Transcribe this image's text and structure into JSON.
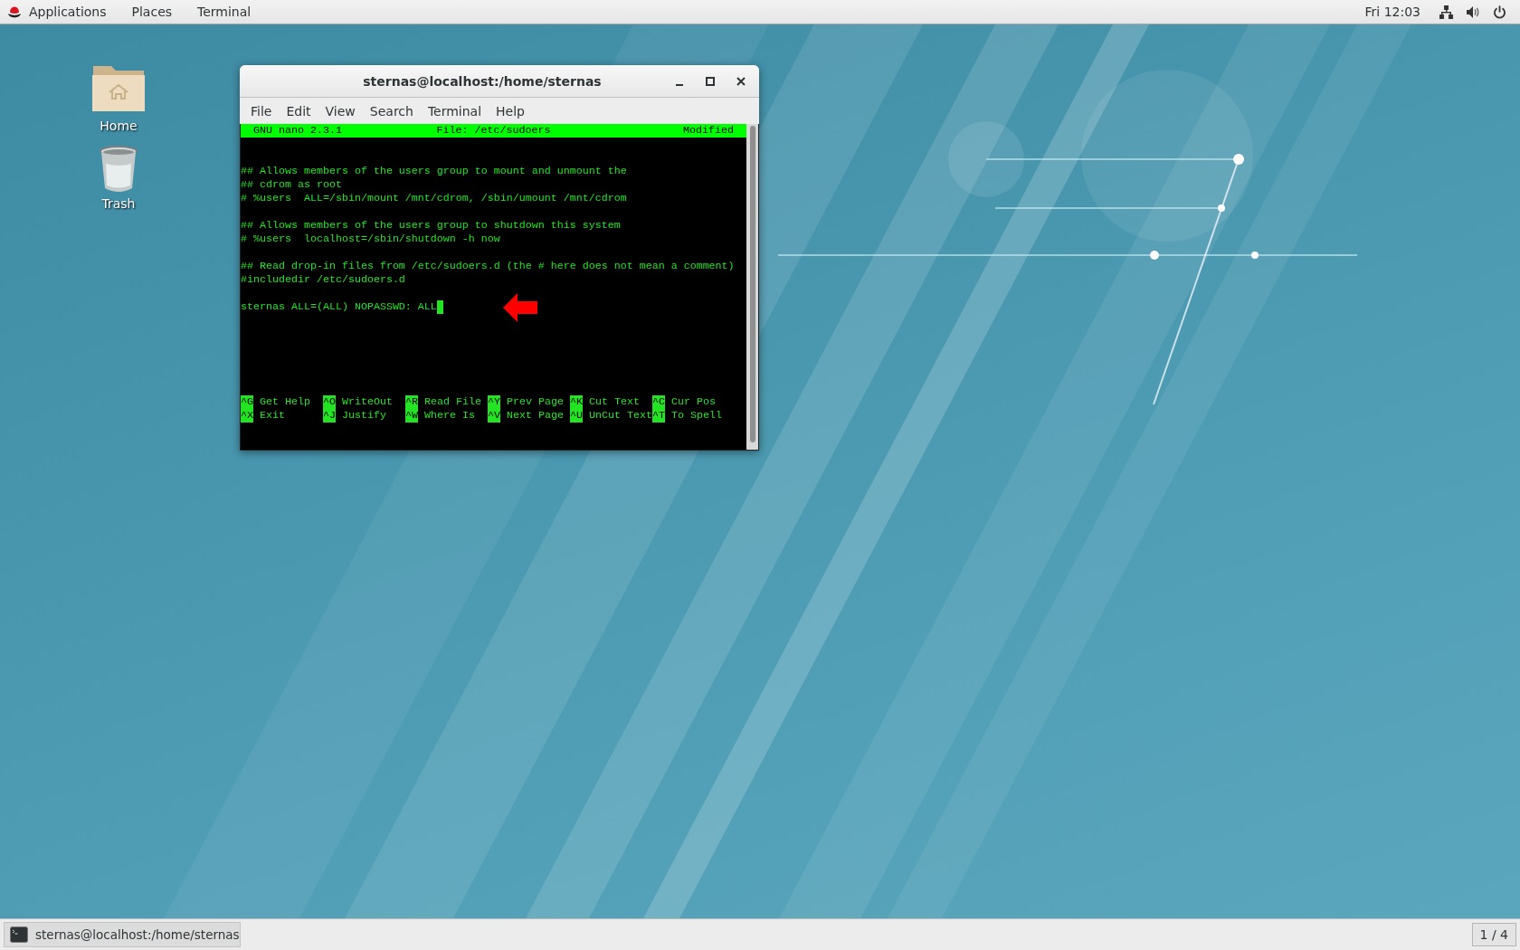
{
  "top_bar": {
    "menus": [
      {
        "label": "Applications"
      },
      {
        "label": "Places"
      },
      {
        "label": "Terminal"
      }
    ],
    "clock": "Fri 12:03"
  },
  "desktop_icons": [
    {
      "label": "Home",
      "kind": "folder"
    },
    {
      "label": "Trash",
      "kind": "trash"
    }
  ],
  "window": {
    "title": "sternas@localhost:/home/sternas",
    "menu": [
      "File",
      "Edit",
      "View",
      "Search",
      "Terminal",
      "Help"
    ],
    "nano": {
      "version": "GNU nano 2.3.1",
      "file": "File: /etc/sudoers",
      "status": "Modified",
      "blocks": [
        [
          {
            "text": "## Allows members of the users group to mount and unmount the",
            "cursor": false
          },
          {
            "text": "## cdrom as root",
            "cursor": false
          },
          {
            "text": "# %users  ALL=/sbin/mount /mnt/cdrom, /sbin/umount /mnt/cdrom",
            "cursor": false
          }
        ],
        [
          {
            "text": "## Allows members of the users group to shutdown this system",
            "cursor": false
          },
          {
            "text": "# %users  localhost=/sbin/shutdown -h now",
            "cursor": false
          }
        ],
        [
          {
            "text": "## Read drop-in files from /etc/sudoers.d (the # here does not mean a comment)",
            "cursor": false
          },
          {
            "text": "#includedir /etc/sudoers.d",
            "cursor": false
          }
        ],
        [
          {
            "text": "sternas ALL=(ALL) NOPASSWD: ALL",
            "cursor": true
          }
        ]
      ],
      "shortcuts": [
        [
          {
            "key": "^G",
            "label": "Get Help"
          },
          {
            "key": "^O",
            "label": "WriteOut"
          },
          {
            "key": "^R",
            "label": "Read File"
          },
          {
            "key": "^Y",
            "label": "Prev Page"
          },
          {
            "key": "^K",
            "label": "Cut Text"
          },
          {
            "key": "^C",
            "label": "Cur Pos"
          }
        ],
        [
          {
            "key": "^X",
            "label": "Exit"
          },
          {
            "key": "^J",
            "label": "Justify"
          },
          {
            "key": "^W",
            "label": "Where Is"
          },
          {
            "key": "^V",
            "label": "Next Page"
          },
          {
            "key": "^U",
            "label": "UnCut Text"
          },
          {
            "key": "^T",
            "label": "To Spell"
          }
        ]
      ]
    }
  },
  "taskbar": {
    "tasks": [
      {
        "label": "sternas@localhost:/home/sternas"
      }
    ],
    "workspace": "1 / 4"
  }
}
